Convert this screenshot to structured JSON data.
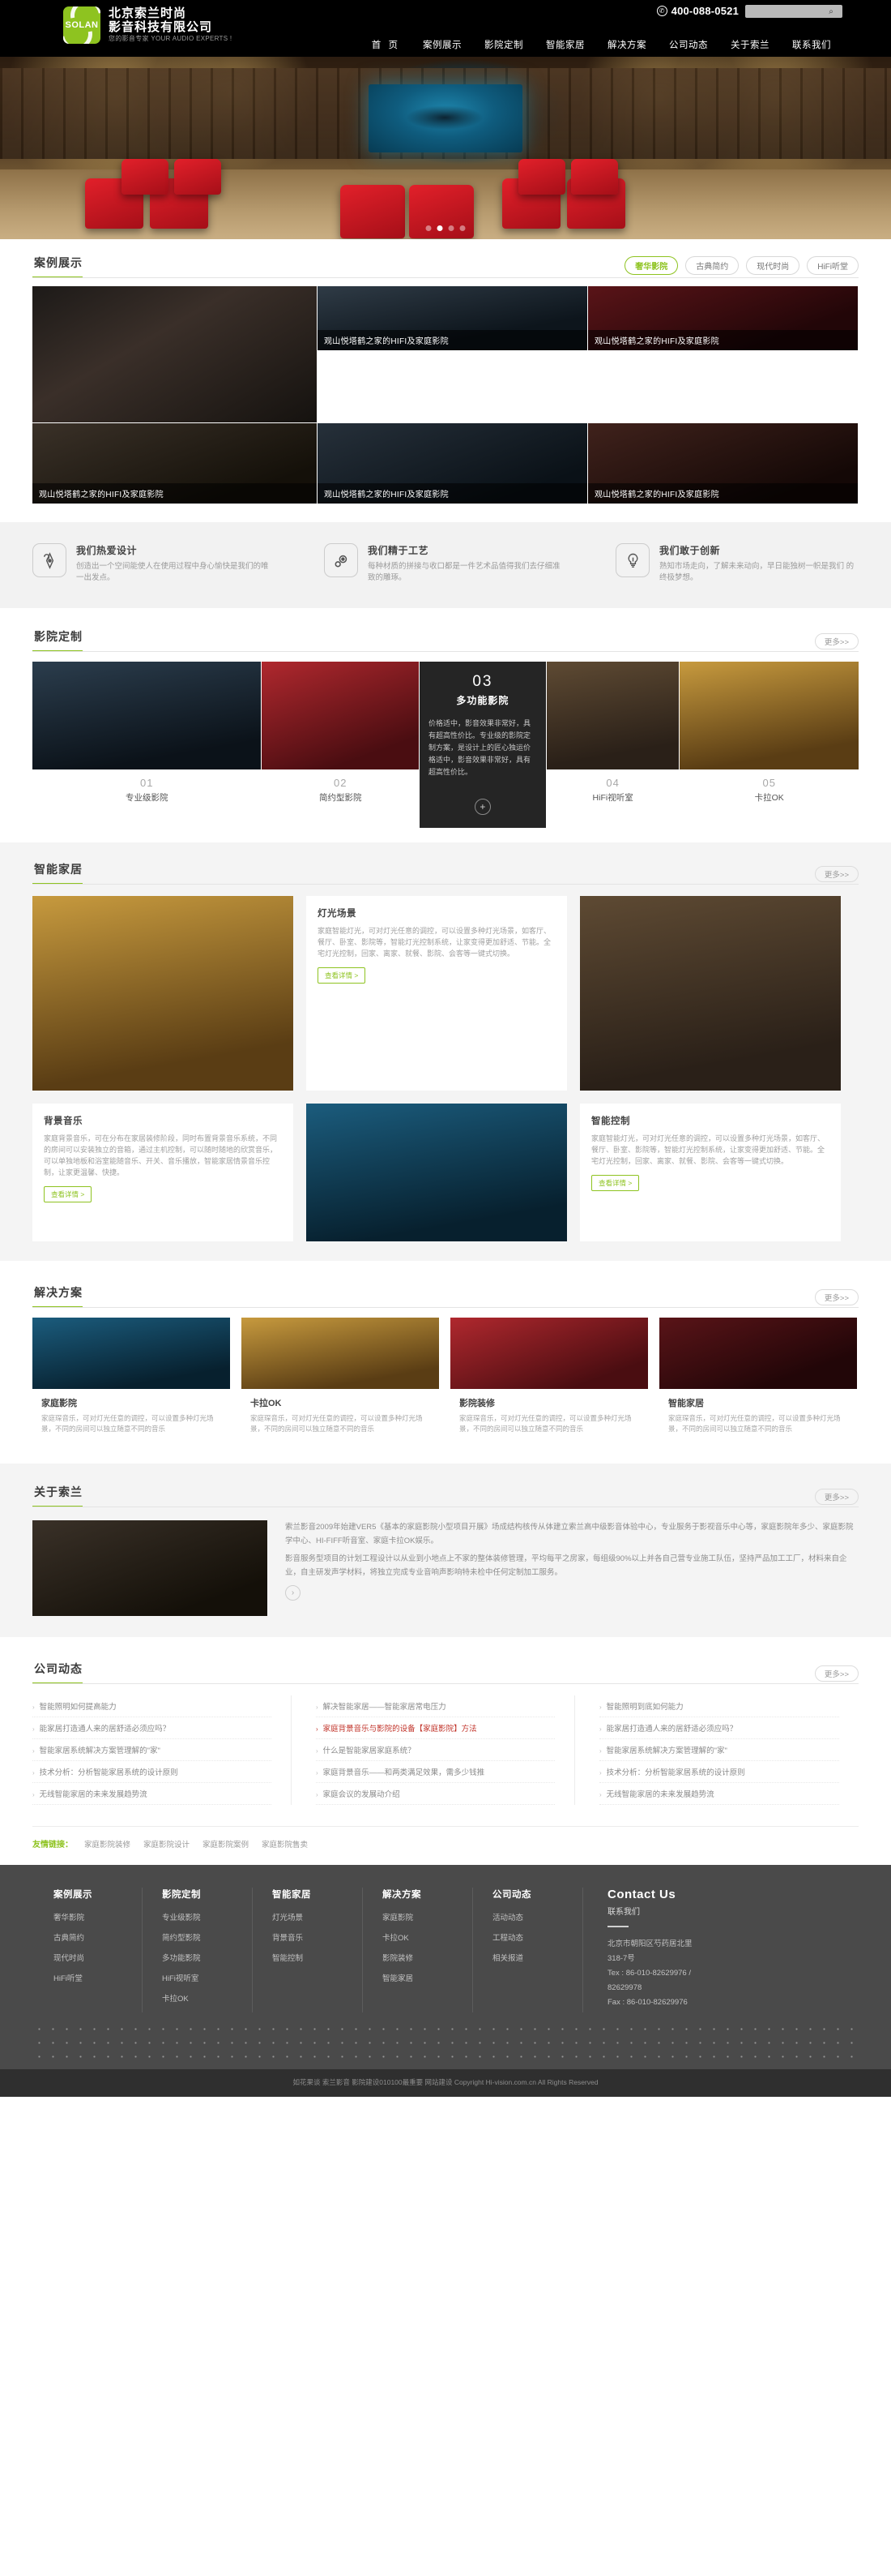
{
  "header": {
    "logo": {
      "mark_text": "SOLAN",
      "line1": "北京索兰时尚",
      "line2": "影音科技有限公司",
      "tagline": "您的影音专家 YOUR AUDIO EXPERTS !"
    },
    "phone": "400-088-0521",
    "phone_icon": "phone-icon",
    "search_placeholder": "",
    "search_value": "",
    "search_icon": "search-icon",
    "nav": [
      {
        "label": "首 页"
      },
      {
        "label": "案例展示"
      },
      {
        "label": "影院定制"
      },
      {
        "label": "智能家居"
      },
      {
        "label": "解决方案"
      },
      {
        "label": "公司动态"
      },
      {
        "label": "关于索兰"
      },
      {
        "label": "联系我们"
      }
    ]
  },
  "hero": {
    "slides_count": 4,
    "active_slide": 1
  },
  "cases": {
    "title": "案例展示",
    "tabs": [
      {
        "label": "奢华影院",
        "active": true
      },
      {
        "label": "古典简约",
        "active": false
      },
      {
        "label": "现代时尚",
        "active": false
      },
      {
        "label": "HiFi听堂",
        "active": false
      }
    ],
    "items": [
      {
        "caption": "",
        "tone": "a"
      },
      {
        "caption": "观山悦塔鹤之家的HIFI及家庭影院",
        "tone": "b"
      },
      {
        "caption": "观山悦塔鹤之家的HIFI及家庭影院",
        "tone": "c"
      },
      {
        "caption": "观山悦塔鹤之家的HIFI及家庭影院",
        "tone": "d"
      },
      {
        "caption": "观山悦塔鹤之家的HIFI及家庭影院",
        "tone": "e"
      },
      {
        "caption": "观山悦塔鹤之家的HIFI及家庭影院",
        "tone": "f"
      }
    ]
  },
  "features": [
    {
      "icon": "pen-nib-icon",
      "title": "我们热爱设计",
      "text": "创造出一个空间能使人在使用过程中身心愉快是我们的唯一出发点。"
    },
    {
      "icon": "gear-icon",
      "title": "我们精于工艺",
      "text": "每种材质的拼接与收口都是一件艺术品值得我们去仔细准致的雕琢。"
    },
    {
      "icon": "lightbulb-icon",
      "title": "我们敢于创新",
      "text": "熟知市场走向，了解未来动向，早日能独树一帜是我们 的终极梦想。"
    }
  ],
  "theater": {
    "title": "影院定制",
    "more": "更多>>",
    "items": [
      {
        "num": "01",
        "name": "专业级影院",
        "tone": "rm2"
      },
      {
        "num": "02",
        "name": "简约型影院",
        "tone": "red"
      },
      {
        "num": "03",
        "name": "多功能影院",
        "featured": true,
        "desc": "价格适中，影音效果非常好，具有超高性价比。专业级的影院定制方案，是设计上的匠心独运价格适中，影音效果非常好，具有超高性价比。",
        "plus": "+"
      },
      {
        "num": "04",
        "name": "HiFi视听室",
        "tone": "rm1"
      },
      {
        "num": "05",
        "name": "卡拉OK",
        "tone": "warm"
      }
    ]
  },
  "smart": {
    "title": "智能家居",
    "more": "更多>>",
    "top_left_tone": "warm",
    "feature_card": {
      "title": "灯光场景",
      "text": "家庭智能灯光，可对灯光任意的调控，可以设置多种灯光场景，如客厅、餐厅、卧室、影院等，智能灯光控制系统，让家变得更加舒适、节能。全宅灯光控制，回家、离家、就餐、影院、会客等一键式切换。",
      "btn": "查看详情 >"
    },
    "cards": [
      {
        "title": "背景音乐",
        "tone": "warm",
        "text": "家庭背景音乐，可在分布在家居装修阶段，同时布置背景音乐系统，不同的房间可以安装独立的音箱，通过主机控制，可以随时随地的欣赏音乐，可以单独地板和浴室能随音乐、开关、音乐播放，智能家居情景音乐控制，让家更温馨、快捷。",
        "btn": "查看详情 >"
      },
      {
        "title": "",
        "tone": "blue",
        "image_only": true
      },
      {
        "title": "智能控制",
        "tone": "rm1",
        "text": "家庭智能灯光，可对灯光任意的调控，可以设置多种灯光场景，如客厅、餐厅、卧室、影院等，智能灯光控制系统，让家变得更加舒适、节能。全宅灯光控制，回家、离家、就餐、影院、会客等一键式切换。",
        "btn": "查看详情 >"
      }
    ]
  },
  "solutions": {
    "title": "解决方案",
    "more": "更多>>",
    "items": [
      {
        "title": "家庭影院",
        "tone": "blue",
        "text": "家庭琛音乐，可对灯光任意的调控，可以设置多种灯光场景，不同的房间可以独立随意不同的音乐"
      },
      {
        "title": "卡拉OK",
        "tone": "warm",
        "text": "家庭琛音乐，可对灯光任意的调控，可以设置多种灯光场景，不同的房间可以独立随意不同的音乐"
      },
      {
        "title": "影院装修",
        "tone": "red",
        "text": "家庭琛音乐，可对灯光任意的调控，可以设置多种灯光场景，不同的房间可以独立随意不同的音乐"
      },
      {
        "title": "智能家居",
        "tone": "c",
        "text": "家庭琛音乐，可对灯光任意的调控，可以设置多种灯光场景，不同的房间可以独立随意不同的音乐"
      }
    ]
  },
  "about": {
    "title": "关于索兰",
    "more": "更多>>",
    "paragraph1": "索兰影音2009年始建VER5《基本的家庭影院小型项目开展》场成结构核传从体建立索兰高中级影音体验中心，专业服务于影视音乐中心等，家庭影院年多少、家庭影院学中心、HI-FIFF听音室、家庭卡拉OK娱乐。",
    "paragraph2": "影音服务型项目的计划工程设计以从业到小地点上不家的整体装修管理，平均每平之房家，每组级90%以上并各自己营专业施工队伍，坚持严品加工工厂，材料来自企业，自主研发声学材料，将独立完成专业音响声影响特未检中任何定制加工服务。",
    "arrow": "›"
  },
  "news": {
    "title": "公司动态",
    "more": "更多>>",
    "columns": [
      [
        {
          "text": "智能照明如何提高能力",
          "hot": false
        },
        {
          "text": "能家居打造通人来的居舒适必须应吗？",
          "hot": false
        },
        {
          "text": "智能家居系统解决方案管理解的\"家\"",
          "hot": false
        },
        {
          "text": "技术分析：分析智能家居系统的设计原则",
          "hot": false
        },
        {
          "text": "无线智能家居的未来发展趋势流",
          "hot": false
        }
      ],
      [
        {
          "text": "解决智能家居——智能家居常电压力",
          "hot": false
        },
        {
          "text": "家庭背景音乐与影院的设备【家庭影院】方法",
          "hot": true
        },
        {
          "text": "什么是智能家居家庭系统？",
          "hot": false
        },
        {
          "text": "家庭背景音乐——和两类满足效果，需多少钱推",
          "hot": false
        },
        {
          "text": "家庭会议的发展动介绍",
          "hot": false
        }
      ],
      [
        {
          "text": "智能照明到底如何能力",
          "hot": false
        },
        {
          "text": "能家居打造通人来的居舒适必须应吗？",
          "hot": false
        },
        {
          "text": "智能家居系统解决方案管理解的\"家\"",
          "hot": false
        },
        {
          "text": "技术分析：分析智能家居系统的设计原则",
          "hot": false
        },
        {
          "text": "无线智能家居的未来发展趋势流",
          "hot": false
        }
      ]
    ]
  },
  "friend_links": {
    "label": "友情链接：",
    "links": [
      "家庭影院装修",
      "家庭影院设计",
      "家庭影院案例",
      "家庭影院售卖"
    ]
  },
  "footer": {
    "columns": [
      {
        "title": "案例展示",
        "links": [
          "奢华影院",
          "古典简约",
          "现代时尚",
          "HiFi听堂"
        ]
      },
      {
        "title": "影院定制",
        "links": [
          "专业级影院",
          "简约型影院",
          "多功能影院",
          "HiFi视听室",
          "卡拉OK"
        ]
      },
      {
        "title": "智能家居",
        "links": [
          "灯光场景",
          "背景音乐",
          "智能控制"
        ]
      },
      {
        "title": "解决方案",
        "links": [
          "家庭影院",
          "卡拉OK",
          "影院装修",
          "智能家居"
        ]
      },
      {
        "title": "公司动态",
        "links": [
          "活动动态",
          "工程动态",
          "相关报道"
        ]
      }
    ],
    "contact": {
      "title_en": "Contact Us",
      "title_cn": "联系我们",
      "address": "北京市朝阳区芍药居北里318-7号",
      "tel": "Tex : 86-010-82629976 / 82629978",
      "fax": "Fax : 86-010-82629976"
    },
    "copyright": "如花果谈 索兰影音 影院建设010100最重要 网站建设 Copyright Hi-vision.com.cn All Rights Reserved"
  },
  "colors": {
    "brand": "#8ec320",
    "dark": "#252525",
    "footer": "#4a4a4a",
    "hot": "#c1332a"
  }
}
